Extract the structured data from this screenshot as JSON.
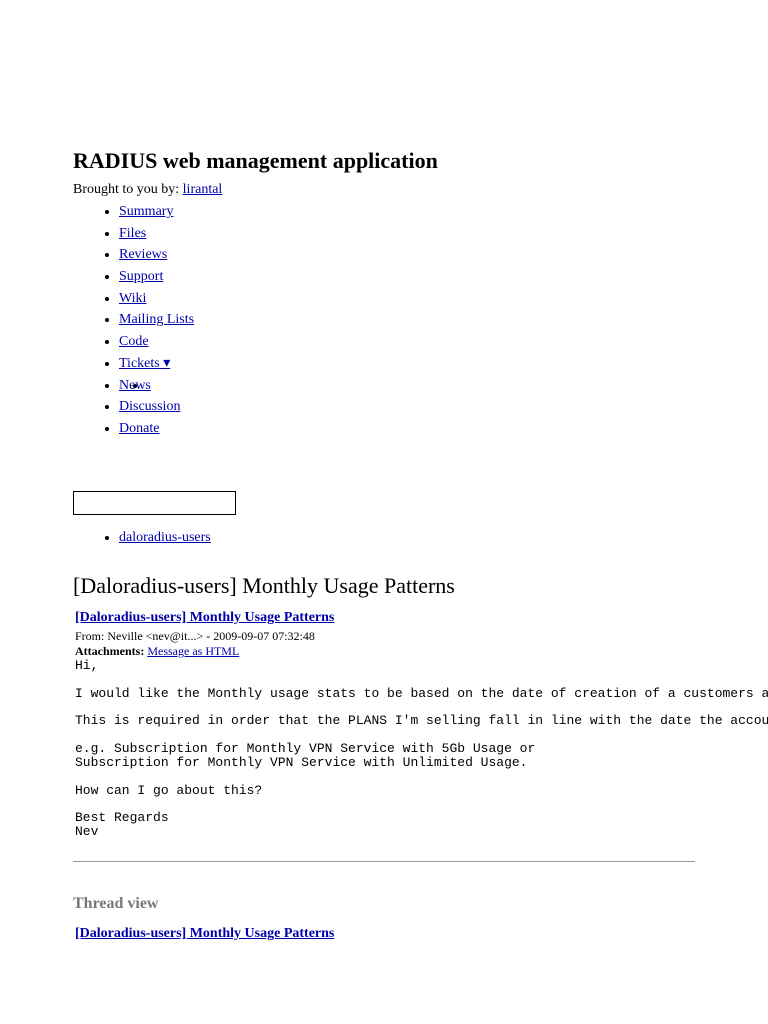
{
  "header": {
    "title": "RADIUS web management application",
    "brought_by_label": "Brought to you by:",
    "author": "lirantal"
  },
  "nav": [
    {
      "label": "Summary"
    },
    {
      "label": "Files"
    },
    {
      "label": "Reviews"
    },
    {
      "label": "Support"
    },
    {
      "label": "Wiki"
    },
    {
      "label": "Mailing Lists"
    },
    {
      "label": "Code"
    },
    {
      "label": "Tickets ▾"
    },
    {
      "label": "News"
    },
    {
      "label": "Discussion"
    },
    {
      "label": "Donate"
    }
  ],
  "search": {
    "value": "",
    "placeholder": ""
  },
  "lists": [
    {
      "label": "daloradius-users"
    }
  ],
  "page_title": "[Daloradius-users] Monthly Usage Patterns",
  "message": {
    "subject": "[Daloradius-users] Monthly Usage Patterns",
    "from": "From: Neville <nev@it...> - 2009-09-07 07:32:48",
    "attachments_label": "Attachments:",
    "attachment": "Message as HTML",
    "body": "Hi,\n\nI would like the Monthly usage stats to be based on the date of creation of a customers ac\n\nThis is required in order that the PLANS I'm selling fall in line with the date the accoun\n\ne.g. Subscription for Monthly VPN Service with 5Gb Usage or\nSubscription for Monthly VPN Service with Unlimited Usage.\n\nHow can I go about this?\n\nBest Regards\nNev"
  },
  "thread": {
    "heading": "Thread view",
    "item": "[Daloradius-users] Monthly Usage Patterns"
  }
}
